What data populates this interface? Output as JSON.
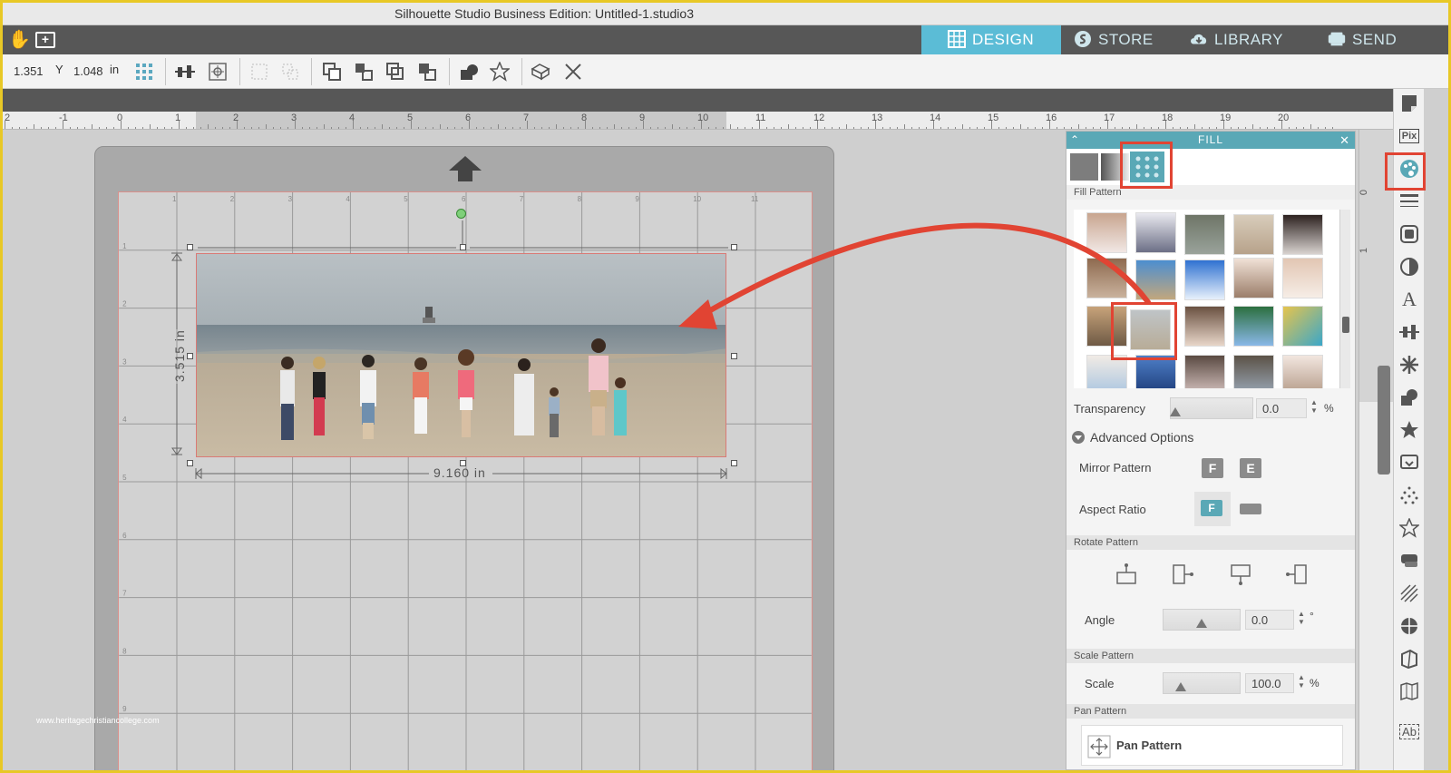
{
  "window": {
    "title": "Silhouette Studio Business Edition: Untitled-1.studio3"
  },
  "modes": {
    "design": "DESIGN",
    "store": "STORE",
    "library": "LIBRARY",
    "send": "SEND"
  },
  "toolbar": {
    "x_value": "1.351",
    "y_label": "Y",
    "y_value": "1.048",
    "unit": "in"
  },
  "ruler": {
    "h_labels": [
      "2",
      "-1",
      "0",
      "1",
      "2",
      "3",
      "4",
      "5",
      "6",
      "7",
      "8",
      "9",
      "10",
      "11",
      "12",
      "13",
      "14",
      "15",
      "16",
      "17",
      "18",
      "19",
      "20"
    ],
    "v_labels": [
      "0",
      "1"
    ]
  },
  "canvas": {
    "height_dim": "3.515 in",
    "width_dim": "9.160 in",
    "grid_col_labels": [
      "1",
      "2",
      "3",
      "4",
      "5",
      "6",
      "7",
      "8",
      "9",
      "10",
      "11"
    ],
    "grid_row_labels": [
      "1",
      "2",
      "3",
      "4",
      "5",
      "6",
      "7",
      "8",
      "9"
    ],
    "watermark": "www.heritagechristiancollege.com"
  },
  "fill_panel": {
    "title": "FILL",
    "fill_pattern_label": "Fill Pattern",
    "transparency_label": "Transparency",
    "transparency_value": "0.0",
    "transparency_unit": "%",
    "advanced_options_label": "Advanced Options",
    "mirror_pattern_label": "Mirror Pattern",
    "aspect_ratio_label": "Aspect Ratio",
    "rotate_pattern_label": "Rotate Pattern",
    "angle_label": "Angle",
    "angle_value": "0.0",
    "angle_unit": "°",
    "scale_pattern_label": "Scale Pattern",
    "scale_label": "Scale",
    "scale_value": "100.0",
    "scale_unit": "%",
    "pan_pattern_section": "Pan Pattern",
    "pan_pattern_button": "Pan Pattern",
    "mirror_h_glyph": "F",
    "mirror_v_glyph": "E",
    "aspect_glyph": "F"
  },
  "right_toolbar": {
    "pix_label": "Pix",
    "text_glyph": "A",
    "ab_glyph": "Ab"
  },
  "colors": {
    "accent": "#5bbcd6",
    "panel_header": "#5aa8b6",
    "highlight": "#e14433"
  }
}
